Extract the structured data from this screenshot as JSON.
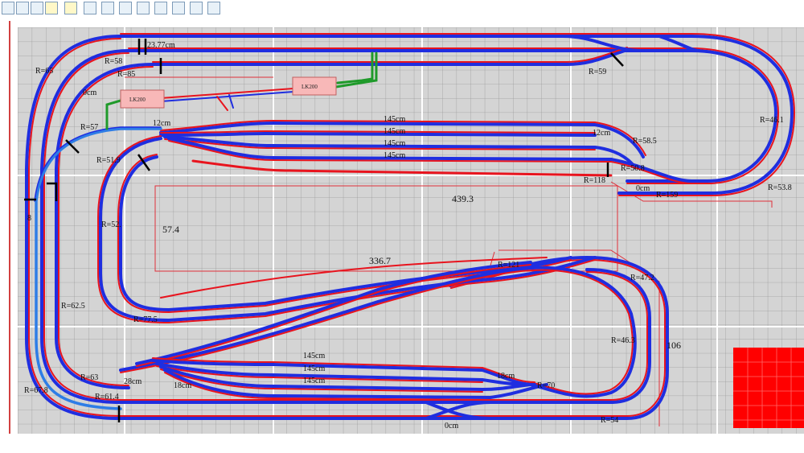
{
  "toolbar": {
    "buttons": [
      "lightning-tool",
      "lightning-tool",
      "lightning-tool",
      "cursor-tool",
      "track-tool",
      "track-tool",
      "track-tool",
      "track-tool",
      "track-tool",
      "track-tool",
      "track-tool",
      "track-tool"
    ]
  },
  "colors": {
    "grid_bg": "#d4d4d4",
    "grid_line": "#9c9c9c",
    "major_line": "#ffffff",
    "rail_red": "#e8141e",
    "rail_blue": "#1f2ee0",
    "siding_blue": "#2e7de6",
    "siding_green": "#1f9a2a",
    "platform_fill": "#ff0000"
  },
  "labels": {
    "r65": "R=65",
    "r58": "R=58",
    "r85": "R=85",
    "l0cm_a": "0cm",
    "r57": "R=57",
    "l12cm_a": "12cm",
    "r519": "R=51.9",
    "r8": "8",
    "r52": "R=52.",
    "r625": "R=62.5",
    "r775": "R=77.5",
    "r63": "R=63",
    "r678": "R=67.8",
    "r614": "R=61.4",
    "l28cm": "28cm",
    "l18cm_a": "18cm",
    "l23_77cm": "23.77cm",
    "r59": "R=59",
    "r461": "R=46.1",
    "l145_1": "145cm",
    "l145_2": "145cm",
    "l145_3": "145cm",
    "l145_4": "145cm",
    "l12cm_b": "12cm",
    "r585": "R=58.5",
    "r508": "R=50.8",
    "r118": "R=118",
    "l0cm_b": "0cm",
    "r159": "R=159",
    "r538": "R=53.8",
    "d4393": "439.3",
    "d574": "57.4",
    "d3367": "336.7",
    "r121": "R=121",
    "r472": "R=47.2",
    "r463": "R=46.3",
    "d106": "106",
    "l145_5": "145cm",
    "l145_6": "145cm",
    "l145_7": "145cm",
    "l18cm_b": "18cm",
    "r70": "R=70",
    "r54": "R=54",
    "l0cm_c": "0cm",
    "lk1": "LK200",
    "lk2": "LK200"
  }
}
